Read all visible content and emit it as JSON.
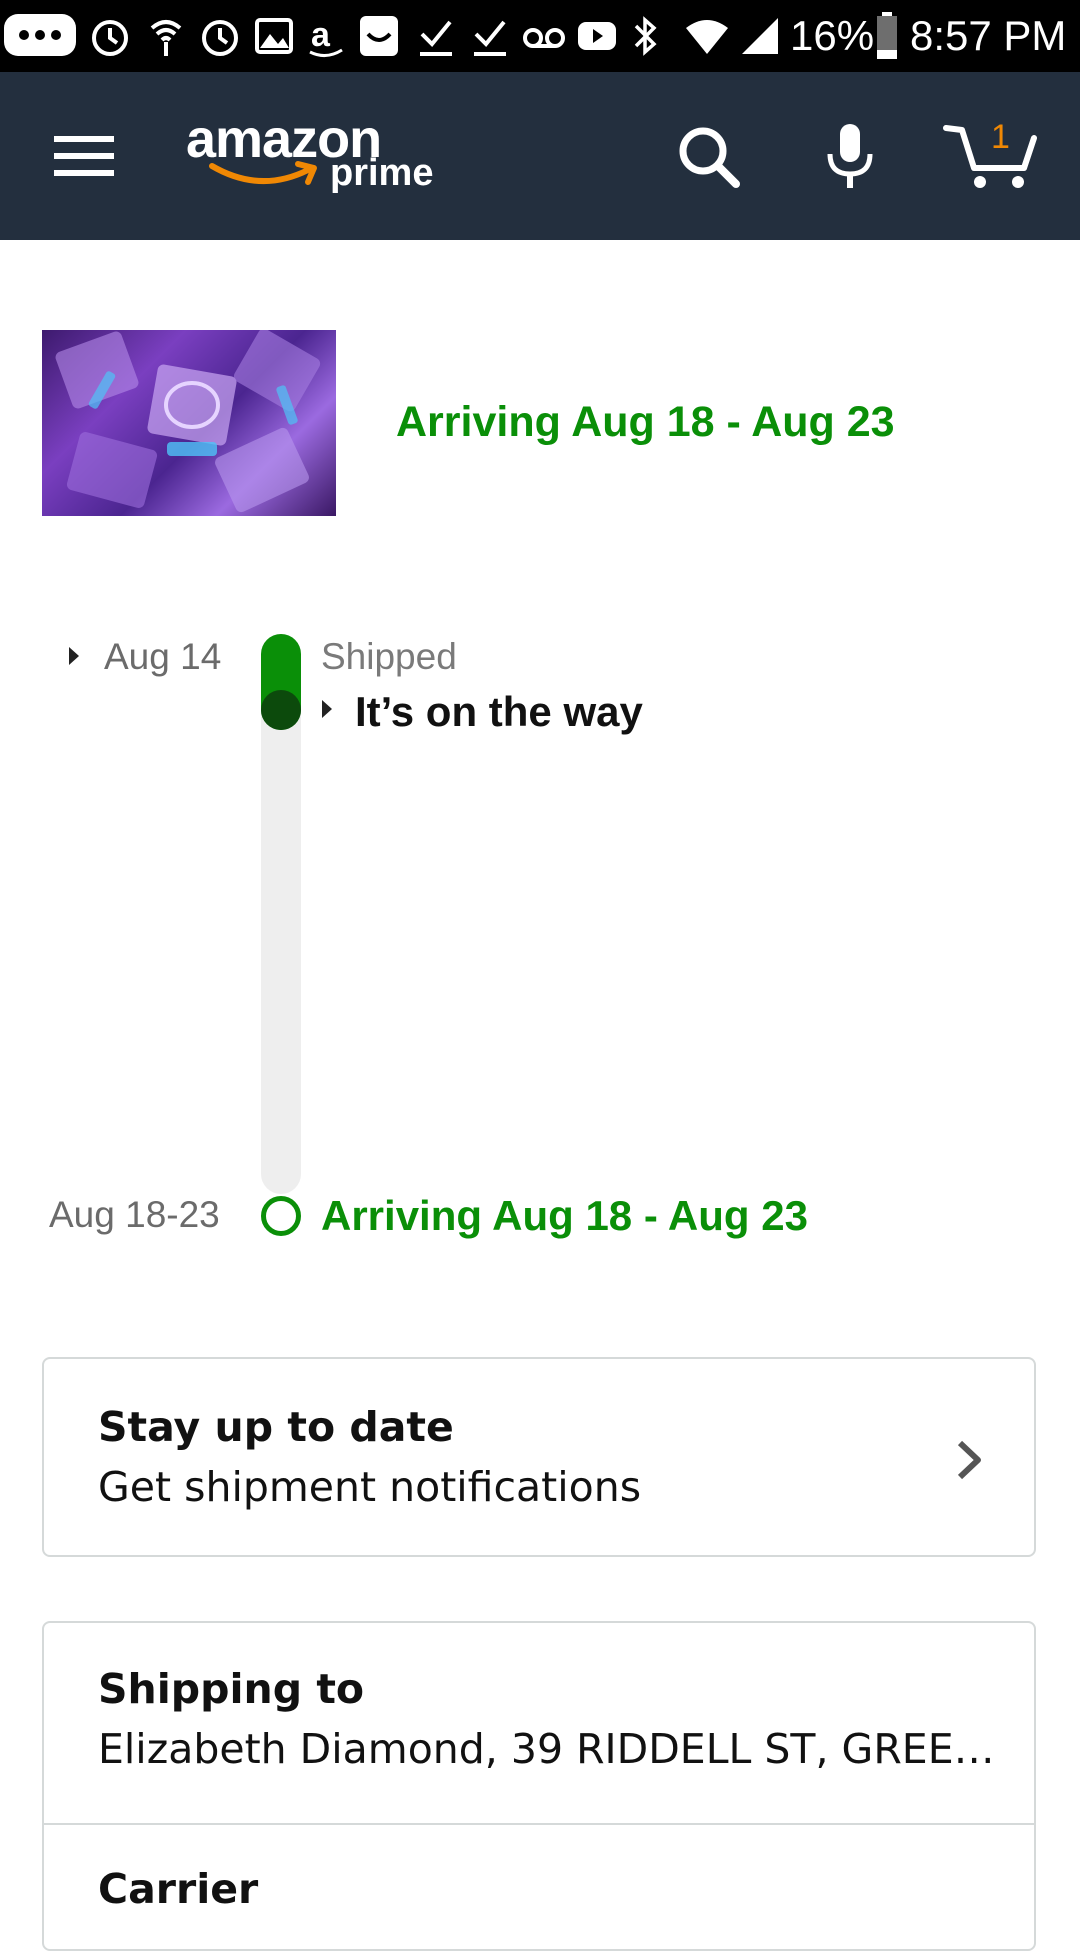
{
  "status_bar": {
    "battery": "16%",
    "time": "8:57 PM",
    "icons": [
      "more-icon",
      "alarm-icon",
      "wireless-icon",
      "alarm-icon",
      "gallery-icon",
      "amazon-icon",
      "smile-icon",
      "check-icon",
      "check-icon",
      "voicemail-icon",
      "youtube-icon",
      "bluetooth-icon",
      "wifi-icon",
      "signal-icon",
      "battery-icon"
    ]
  },
  "header": {
    "logo_main": "amazon",
    "logo_sub": "prime",
    "cart_count": "1",
    "bg_color": "#232f3e",
    "accent_color": "#f08804"
  },
  "shipment": {
    "arriving_headline": "Arriving Aug 18 - Aug 23",
    "accent_color": "#0a8f08"
  },
  "timeline": {
    "shipped_date": "Aug 14",
    "shipped_label": "Shipped",
    "shipped_status": "It’s on the way",
    "arrival_date": "Aug 18-23",
    "arrival_status": "Arriving Aug 18 - Aug 23"
  },
  "cards": {
    "notifications": {
      "title": "Stay up to date",
      "subtitle": "Get shipment notifications"
    },
    "shipping": {
      "title": "Shipping to",
      "address": "Elizabeth Diamond, 39 RIDDELL ST, GREE…"
    },
    "carrier": {
      "title": "Carrier"
    }
  }
}
